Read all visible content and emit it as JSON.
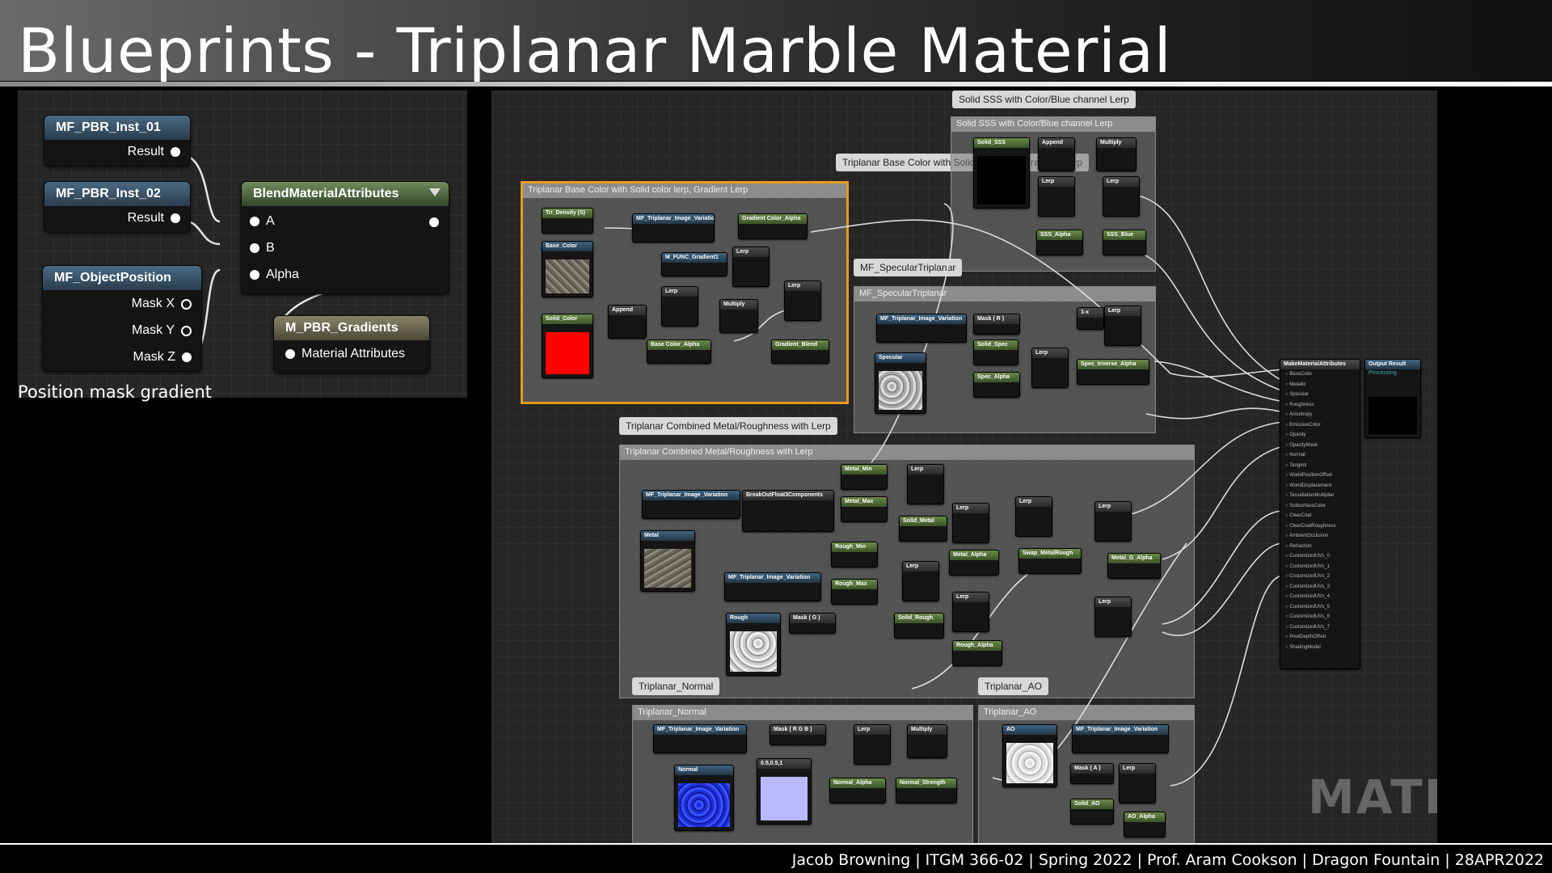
{
  "title": "Blueprints - Triplanar Marble Material",
  "footer": "Jacob Browning  | ITGM 366-02  | Spring 2022 |  Prof. Aram Cookson  |  Dragon Fountain  |  28APR2022",
  "left_graph": {
    "node1": {
      "title": "MF_PBR_Inst_01",
      "pin": "Result"
    },
    "node2": {
      "title": "MF_PBR_Inst_02",
      "pin": "Result"
    },
    "node3": {
      "title": "MF_ObjectPosition",
      "pins": [
        "Mask X",
        "Mask Y",
        "Mask Z"
      ]
    },
    "blend": {
      "title": "BlendMaterialAttributes",
      "pins": [
        "A",
        "B",
        "Alpha"
      ]
    },
    "gradients": {
      "title": "M_PBR_Gradients",
      "pin": "Material Attributes"
    },
    "caption": "Position mask gradient"
  },
  "comments": {
    "base": "Triplanar Base Color with Solid color lerp, Gradient Lerp",
    "sss": "Solid SSS with Color/Blue channel Lerp",
    "spec": "MF_SpecularTriplanar",
    "metal": "Triplanar Combined Metal/Roughness with Lerp",
    "normal": "Triplanar_Normal",
    "ao": "Triplanar_AO"
  },
  "nodes": {
    "tri_density": "Tri_Density (S)",
    "base_color": "Base_Color",
    "solid_color": "Solid_Color",
    "tri_var": "MF_Triplanar_Image_Variation",
    "grad_alpha": "Gradient Color_Alpha",
    "func_grad": "M_FUNC_Gradient1",
    "lerp": "Lerp",
    "append": "Append",
    "multiply": "Multiply",
    "base_alpha": "Base Color_Alpha",
    "grad_blend": "Gradient_Blend",
    "solid_sss": "Solid_SSS",
    "sss_alpha": "SSS_Alpha",
    "sss_blue": "SSS_Blue",
    "mask_r": "Mask ( R )",
    "solid_spec": "Solid_Spec",
    "spec_alpha": "Spec_Alpha",
    "specular": "Specular",
    "spec_inv": "Spec_Inverse_Alpha",
    "one_x": "1-x",
    "metal_min": "Metal_Min",
    "metal_max": "Metal_Max",
    "breakout": "BreakOutFloat3Components",
    "metal": "Metal",
    "solid_metal": "Solid_Metal",
    "metal_alpha": "Metal_Alpha",
    "swap": "Swap_MetalRough",
    "metal_g_alpha": "Metal_G_Alpha",
    "rough_min": "Rough_Min",
    "rough_max": "Rough_Max",
    "rough": "Rough",
    "mask_g": "Mask ( G )",
    "solid_rough": "Solid_Rough",
    "rough_alpha": "Rough_Alpha",
    "mask_rgb": "Mask ( R G B )",
    "normal": "Normal",
    "const": "0.5,0.5,1",
    "normal_alpha": "Normal_Alpha",
    "normal_strength": "Normal_Strength",
    "ao": "AO",
    "mask_a": "Mask ( A )",
    "solid_ao": "Solid_AO",
    "ao_alpha": "AO_Alpha",
    "make_mat": "MakeMaterialAttributes",
    "output": "Output Result",
    "output_sub": "Processing"
  },
  "make_mat_pins": [
    "BaseColor",
    "Metallic",
    "Specular",
    "Roughness",
    "Anisotropy",
    "EmissiveColor",
    "Opacity",
    "OpacityMask",
    "Normal",
    "Tangent",
    "WorldPositionOffset",
    "WorldDisplacement",
    "TessellationMultiplier",
    "SubsurfaceColor",
    "ClearCoat",
    "ClearCoatRoughness",
    "AmbientOcclusion",
    "Refraction",
    "CustomizedUVs_0",
    "CustomizedUVs_1",
    "CustomizedUVs_2",
    "CustomizedUVs_3",
    "CustomizedUVs_4",
    "CustomizedUVs_5",
    "CustomizedUVs_6",
    "CustomizedUVs_7",
    "PixelDepthOffset",
    "ShadingModel"
  ],
  "watermark": "MATEF"
}
